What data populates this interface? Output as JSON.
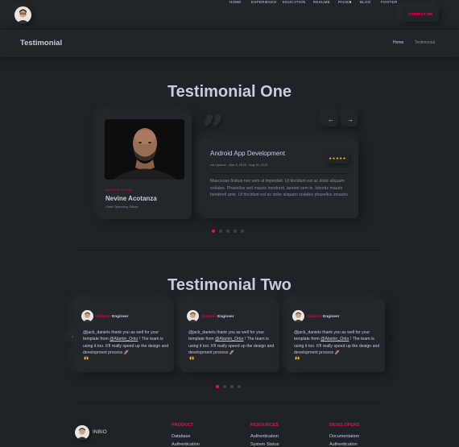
{
  "header": {
    "nav": [
      "HOME",
      "EXPERIENCE",
      "EDUCATION",
      "RESUME",
      "PAGES",
      "BLOG",
      "FOOTER"
    ],
    "pages_caret": "▾",
    "contact": "CONTACT ME"
  },
  "breadcrumb": {
    "title": "Testimonial",
    "home": "Home",
    "separator": "-",
    "current": "Testimonial"
  },
  "testimonial_one": {
    "title": "Testimonial One",
    "role": "RANDOM THEME",
    "name": "Nevine Acotanza",
    "position": "Chief Operating Officer",
    "quote_mark": "”",
    "project": "Android App Development",
    "via": "via Upwork - Mar 4, 2015 - Aug 30, 2021",
    "stars": "★★★★★",
    "body": "Maecenas finibus nec sem ut imperdiet. Ut tincidunt est ac dolor aliquam sodales. Phasellus sed mauris hendrerit, laoreet sem in, lobortis mauris hendrerit ante. Ut tincidunt est ac dolor aliquam sodales phasellus smauris .",
    "prev": "←",
    "next": "→",
    "dots": 5,
    "active_dot": 0
  },
  "testimonial_two": {
    "title": "Testimonial Two",
    "cards": [
      {
        "handle": "@alamin",
        "role": "Engineer",
        "text_a": "@jack_daniels thank you as well for your template from ",
        "mention": "@Alamin_Orko",
        "text_b": " ! The team is using it too. It'll really speed up the design and development process 🚀",
        "emoji": "🙌"
      },
      {
        "handle": "@alamin",
        "role": "Engineer",
        "text_a": "@jack_daniels thank you as well for your template from ",
        "mention": "@Alamin_Orko",
        "text_b": " ! The team is using it too. It'll really speed up the design and development process 🚀",
        "emoji": "🙌"
      },
      {
        "handle": "@alamin",
        "role": "Engineer",
        "text_a": "@jack_daniels thank you as well for your template from ",
        "mention": "@Alamin_Orko",
        "text_b": " ! The team is using it too. It'll really speed up the design and development process 🚀",
        "emoji": "🙌"
      }
    ],
    "prev": "‹",
    "next": "›",
    "dots": 4,
    "active_dot": 0
  },
  "footer": {
    "brand": "INBIO",
    "columns": [
      {
        "title": "PRODUCT",
        "links": [
          "Database",
          "Authentication"
        ]
      },
      {
        "title": "RESOURCES",
        "links": [
          "Authentication",
          "System Status"
        ]
      },
      {
        "title": "DEVELOPERS",
        "links": [
          "Documentation",
          "Authentication"
        ]
      }
    ]
  },
  "colors": {
    "accent": "#ff014f",
    "background": "#1f2226",
    "text": "#c4cfde",
    "muted": "#878e99",
    "star": "#fdb816"
  }
}
